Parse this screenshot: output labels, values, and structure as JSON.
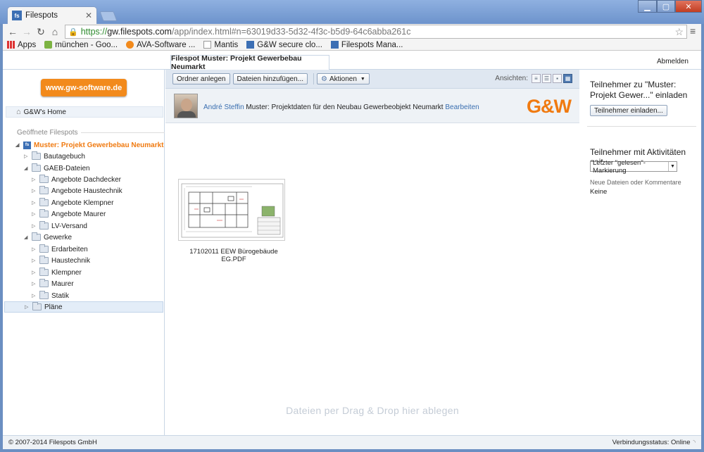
{
  "browser": {
    "tab_title": "Filespots",
    "tab_icon_text": "fs",
    "url_scheme": "https://",
    "url_host": "gw.filespots.com",
    "url_path": "/app/index.html#n=63019d33-5d32-4f3c-b5d9-64c6abba261c",
    "bookmarks": [
      {
        "label": "Apps"
      },
      {
        "label": "münchen - Goo..."
      },
      {
        "label": "AVA-Software ..."
      },
      {
        "label": "Mantis"
      },
      {
        "label": "G&W secure clo..."
      },
      {
        "label": "Filespots Mana..."
      }
    ]
  },
  "header": {
    "space_tab": "Filespot Muster: Projekt Gewerbebau Neumarkt",
    "logout": "Abmelden"
  },
  "left": {
    "gw_button": "www.gw-software.de",
    "home": "G&W's Home",
    "open_label": "Geöffnete Filespots",
    "root": "Muster: Projekt Gewerbebau Neumarkt",
    "tree": [
      {
        "label": "Bautagebuch"
      },
      {
        "label": "GAEB-Dateien"
      },
      {
        "label": "Angebote Dachdecker"
      },
      {
        "label": "Angebote Haustechnik"
      },
      {
        "label": "Angebote Klempner"
      },
      {
        "label": "Angebote Maurer"
      },
      {
        "label": "LV-Versand"
      },
      {
        "label": "Gewerke"
      },
      {
        "label": "Erdarbeiten"
      },
      {
        "label": "Haustechnik"
      },
      {
        "label": "Klempner"
      },
      {
        "label": "Maurer"
      },
      {
        "label": "Statik"
      },
      {
        "label": "Pläne"
      }
    ]
  },
  "toolbar": {
    "new_folder": "Ordner anlegen",
    "add_files": "Dateien hinzufügen...",
    "actions": "Aktionen",
    "views_label": "Ansichten:"
  },
  "info": {
    "user": "André Steffin",
    "text": " Muster: Projektdaten für den Neubau Gewerbeobjekt Neumarkt ",
    "edit": "Bearbeiten",
    "logo": "G&W"
  },
  "files": [
    {
      "name": "17102011 EEW Bürogebäude EG.PDF"
    }
  ],
  "dropzone": "Dateien per Drag & Drop hier ablegen",
  "right": {
    "invite_title": "Teilnehmer zu \"Muster: Projekt Gewer...\" einladen",
    "invite_button": "Teilnehmer einladen...",
    "activity_title": "Teilnehmer mit Aktivitäten seit",
    "activity_select": "Letzter \"gelesen\"-Markierung",
    "new_label": "Neue Dateien oder Kommentare",
    "none_label": "Keine"
  },
  "status": {
    "copyright": "© 2007-2014 Filespots GmbH",
    "connection": "Verbindungsstatus: Online"
  },
  "colors": {
    "accent_orange": "#f28a1c",
    "link_blue": "#3a6fb0",
    "chrome_blue": "#6b8fc2"
  }
}
